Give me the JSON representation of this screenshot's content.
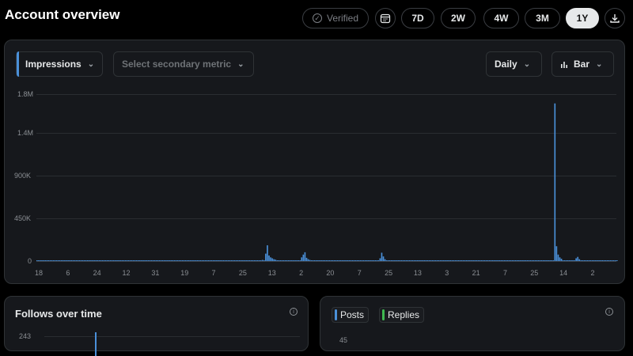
{
  "header": {
    "title": "Account overview",
    "verified_label": "Verified",
    "ranges": [
      "7D",
      "2W",
      "4W",
      "3M",
      "1Y"
    ],
    "active_range": "1Y"
  },
  "main_chart": {
    "primary_metric": "Impressions",
    "secondary_placeholder": "Select secondary metric",
    "interval": "Daily",
    "chart_style": "Bar"
  },
  "chart_data": {
    "type": "bar",
    "title": "",
    "ylabel": "",
    "ytick_labels": [
      "1.8M",
      "1.4M",
      "900K",
      "450K",
      "0"
    ],
    "yticks": [
      1800000,
      1400000,
      900000,
      450000,
      0
    ],
    "ylim": [
      0,
      1800000
    ],
    "xtick_labels": [
      "18",
      "6",
      "24",
      "12",
      "31",
      "19",
      "7",
      "25",
      "13",
      "2",
      "20",
      "7",
      "25",
      "13",
      "3",
      "21",
      "7",
      "25",
      "14",
      "2"
    ],
    "grid": true,
    "series": [
      {
        "name": "Impressions",
        "color": "#4a90d9",
        "values": [
          5000,
          4000,
          5000,
          6000,
          5000,
          4000,
          5000,
          6000,
          5000,
          4000,
          5000,
          6000,
          5000,
          4000,
          5000,
          6000,
          5000,
          4000,
          5000,
          6000,
          5000,
          4000,
          5000,
          6000,
          5000,
          4000,
          5000,
          6000,
          5000,
          4000,
          5000,
          6000,
          5000,
          4000,
          5000,
          6000,
          5000,
          4000,
          5000,
          6000,
          5000,
          4000,
          5000,
          6000,
          5000,
          4000,
          5000,
          6000,
          5000,
          4000,
          5000,
          6000,
          5000,
          4000,
          5000,
          6000,
          5000,
          4000,
          5000,
          6000,
          5000,
          4000,
          5000,
          6000,
          5000,
          4000,
          5000,
          6000,
          5000,
          4000,
          5000,
          6000,
          5000,
          4000,
          5000,
          6000,
          5000,
          4000,
          5000,
          6000,
          5000,
          4000,
          5000,
          6000,
          5000,
          4000,
          5000,
          6000,
          5000,
          4000,
          5000,
          6000,
          5000,
          4000,
          5000,
          6000,
          5000,
          4000,
          5000,
          6000,
          5000,
          4000,
          5000,
          6000,
          5000,
          4000,
          5000,
          6000,
          5000,
          4000,
          5000,
          6000,
          5000,
          4000,
          5000,
          6000,
          5000,
          4000,
          5000,
          6000,
          5000,
          4000,
          5000,
          6000,
          5000,
          4000,
          5000,
          6000,
          5000,
          4000,
          5000,
          6000,
          5000,
          4000,
          5000,
          6000,
          5000,
          4000,
          5000,
          6000,
          5000,
          4000,
          5000,
          6000,
          5000,
          4000,
          5000,
          6000,
          5000,
          4000,
          5000,
          6000,
          5000,
          4000,
          5000,
          6000,
          5000,
          4000,
          5000,
          6000,
          5000,
          4000,
          5000,
          6000,
          5000,
          4000,
          5000,
          6000,
          5000,
          4000,
          5000,
          6000,
          5000,
          4000,
          5000,
          6000,
          5000,
          4000,
          5000,
          6000,
          5000,
          4000,
          5000,
          6000,
          5000,
          4000,
          5000,
          6000,
          5000,
          4000,
          5000,
          6000,
          5000,
          4000,
          5000,
          6000,
          5000,
          4000,
          5000,
          6000,
          5000,
          4000,
          5000,
          6000,
          5000,
          4000,
          5000,
          6000,
          5000,
          4000,
          5000,
          6000,
          5000,
          4000,
          5000,
          6000,
          5000,
          4000,
          5000,
          6000,
          5000,
          4000,
          5000,
          6000,
          5000,
          4000,
          5000,
          6000,
          5000,
          4000,
          5000,
          6000,
          5000,
          4000,
          5000,
          6000,
          5000,
          4000,
          5000,
          6000,
          5000,
          4000,
          5000,
          6000,
          5000,
          4000,
          5000,
          6000,
          5000,
          4000,
          5000,
          6000,
          5000,
          4000,
          5000,
          6000,
          5000,
          4000,
          5000,
          6000,
          5000,
          4000,
          5000,
          6000,
          5000,
          4000,
          5000,
          6000,
          5000,
          4000,
          5000,
          6000,
          5000,
          4000,
          5000,
          6000,
          5000,
          4000,
          5000,
          6000,
          5000,
          4000,
          5000,
          6000,
          5000,
          4000,
          5000,
          6000,
          5000,
          4000,
          5000,
          6000,
          5000,
          4000,
          5000,
          6000,
          5000,
          4000,
          5000,
          6000,
          5000,
          4000,
          5000,
          6000,
          5000,
          4000,
          5000,
          6000,
          5000,
          4000,
          5000,
          6000,
          5000,
          4000,
          5000,
          6000,
          5000,
          4000,
          5000,
          6000,
          5000,
          4000,
          5000,
          6000,
          5000,
          4000,
          5000,
          6000,
          5000,
          4000,
          5000,
          6000,
          5000,
          4000,
          5000,
          6000,
          5000,
          4000,
          5000,
          6000,
          5000,
          4000,
          5000,
          6000,
          5000,
          4000,
          5000,
          6000,
          5000,
          4000,
          5000,
          6000,
          5000,
          4000,
          5000,
          6000
        ]
      }
    ],
    "spikes": [
      {
        "index": 138,
        "value": 12000
      },
      {
        "index": 140,
        "value": 80000
      },
      {
        "index": 141,
        "value": 170000
      },
      {
        "index": 142,
        "value": 60000
      },
      {
        "index": 143,
        "value": 40000
      },
      {
        "index": 144,
        "value": 30000
      },
      {
        "index": 145,
        "value": 20000
      },
      {
        "index": 146,
        "value": 15000
      },
      {
        "index": 162,
        "value": 40000
      },
      {
        "index": 163,
        "value": 70000
      },
      {
        "index": 164,
        "value": 95000
      },
      {
        "index": 165,
        "value": 35000
      },
      {
        "index": 166,
        "value": 20000
      },
      {
        "index": 167,
        "value": 12000
      },
      {
        "index": 210,
        "value": 30000
      },
      {
        "index": 211,
        "value": 90000
      },
      {
        "index": 212,
        "value": 50000
      },
      {
        "index": 213,
        "value": 20000
      },
      {
        "index": 317,
        "value": 1700000
      },
      {
        "index": 318,
        "value": 160000
      },
      {
        "index": 319,
        "value": 70000
      },
      {
        "index": 320,
        "value": 40000
      },
      {
        "index": 321,
        "value": 25000
      },
      {
        "index": 330,
        "value": 30000
      },
      {
        "index": 331,
        "value": 45000
      },
      {
        "index": 332,
        "value": 20000
      },
      {
        "index": 380,
        "value": 15000
      },
      {
        "index": 440,
        "value": 12000
      },
      {
        "index": 519,
        "value": 20000
      },
      {
        "index": 522,
        "value": 25000
      }
    ]
  },
  "follows_panel": {
    "title": "Follows over time",
    "ytick_top": "243"
  },
  "posts_panel": {
    "chips": [
      {
        "label": "Posts",
        "color": "#4a90d9"
      },
      {
        "label": "Replies",
        "color": "#3fb950"
      }
    ],
    "ytick_top": "45"
  }
}
